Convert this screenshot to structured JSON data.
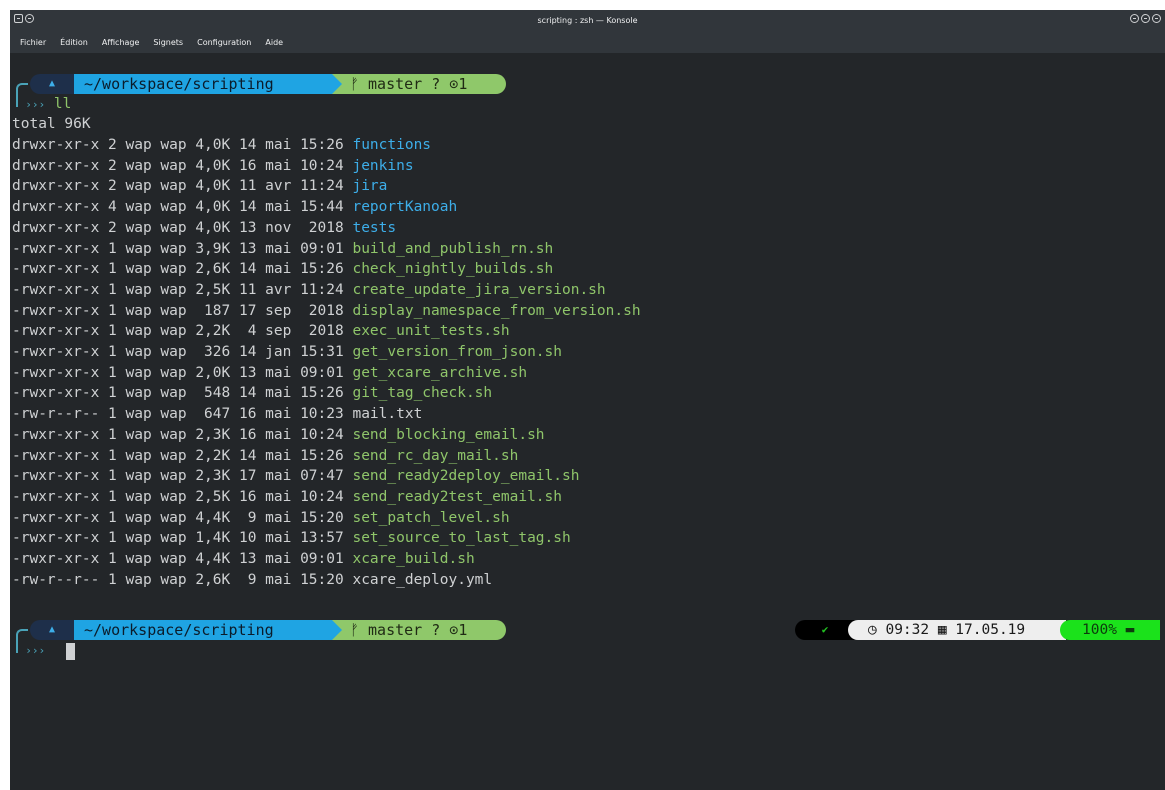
{
  "window": {
    "title": "scripting : zsh — Konsole"
  },
  "menu": [
    "Fichier",
    "Édition",
    "Affichage",
    "Signets",
    "Configuration",
    "Aide"
  ],
  "prompt1": {
    "os_icon": "▲",
    "dir": "~/workspace/scripting",
    "git": "ᚠ master ? ⊙1",
    "command": "ll"
  },
  "listing": {
    "total": "total 96K",
    "entries": [
      {
        "meta": "drwxr-xr-x 2 wap wap 4,0K 14 mai 15:26 ",
        "name": "functions",
        "kind": "dir"
      },
      {
        "meta": "drwxr-xr-x 2 wap wap 4,0K 16 mai 10:24 ",
        "name": "jenkins",
        "kind": "dir"
      },
      {
        "meta": "drwxr-xr-x 2 wap wap 4,0K 11 avr 11:24 ",
        "name": "jira",
        "kind": "dir"
      },
      {
        "meta": "drwxr-xr-x 4 wap wap 4,0K 14 mai 15:44 ",
        "name": "reportKanoah",
        "kind": "dir"
      },
      {
        "meta": "drwxr-xr-x 2 wap wap 4,0K 13 nov  2018 ",
        "name": "tests",
        "kind": "dir"
      },
      {
        "meta": "-rwxr-xr-x 1 wap wap 3,9K 13 mai 09:01 ",
        "name": "build_and_publish_rn.sh",
        "kind": "exe"
      },
      {
        "meta": "-rwxr-xr-x 1 wap wap 2,6K 14 mai 15:26 ",
        "name": "check_nightly_builds.sh",
        "kind": "exe"
      },
      {
        "meta": "-rwxr-xr-x 1 wap wap 2,5K 11 avr 11:24 ",
        "name": "create_update_jira_version.sh",
        "kind": "exe"
      },
      {
        "meta": "-rwxr-xr-x 1 wap wap  187 17 sep  2018 ",
        "name": "display_namespace_from_version.sh",
        "kind": "exe"
      },
      {
        "meta": "-rwxr-xr-x 1 wap wap 2,2K  4 sep  2018 ",
        "name": "exec_unit_tests.sh",
        "kind": "exe"
      },
      {
        "meta": "-rwxr-xr-x 1 wap wap  326 14 jan 15:31 ",
        "name": "get_version_from_json.sh",
        "kind": "exe"
      },
      {
        "meta": "-rwxr-xr-x 1 wap wap 2,0K 13 mai 09:01 ",
        "name": "get_xcare_archive.sh",
        "kind": "exe"
      },
      {
        "meta": "-rwxr-xr-x 1 wap wap  548 14 mai 15:26 ",
        "name": "git_tag_check.sh",
        "kind": "exe"
      },
      {
        "meta": "-rw-r--r-- 1 wap wap  647 16 mai 10:23 ",
        "name": "mail.txt",
        "kind": "plain"
      },
      {
        "meta": "-rwxr-xr-x 1 wap wap 2,3K 16 mai 10:24 ",
        "name": "send_blocking_email.sh",
        "kind": "exe"
      },
      {
        "meta": "-rwxr-xr-x 1 wap wap 2,2K 14 mai 15:26 ",
        "name": "send_rc_day_mail.sh",
        "kind": "exe"
      },
      {
        "meta": "-rwxr-xr-x 1 wap wap 2,3K 17 mai 07:47 ",
        "name": "send_ready2deploy_email.sh",
        "kind": "exe"
      },
      {
        "meta": "-rwxr-xr-x 1 wap wap 2,5K 16 mai 10:24 ",
        "name": "send_ready2test_email.sh",
        "kind": "exe"
      },
      {
        "meta": "-rwxr-xr-x 1 wap wap 4,4K  9 mai 15:20 ",
        "name": "set_patch_level.sh",
        "kind": "exe"
      },
      {
        "meta": "-rwxr-xr-x 1 wap wap 1,4K 10 mai 13:57 ",
        "name": "set_source_to_last_tag.sh",
        "kind": "exe"
      },
      {
        "meta": "-rwxr-xr-x 1 wap wap 4,4K 13 mai 09:01 ",
        "name": "xcare_build.sh",
        "kind": "exe"
      },
      {
        "meta": "-rw-r--r-- 1 wap wap 2,6K  9 mai 15:20 ",
        "name": "xcare_deploy.yml",
        "kind": "plain"
      }
    ]
  },
  "prompt2": {
    "os_icon": "▲",
    "dir": "~/workspace/scripting",
    "git": "ᚠ master ? ⊙1",
    "status": "✔",
    "time": "◷ 09:32 ▦ 17.05.19",
    "battery": "100% ▬"
  },
  "colors": {
    "background": "#232629",
    "directory": "#3daee9",
    "executable": "#8fc56a",
    "dir_segment": "#1fa4e3",
    "git_segment": "#8fc86a",
    "battery_segment": "#1be21b"
  }
}
